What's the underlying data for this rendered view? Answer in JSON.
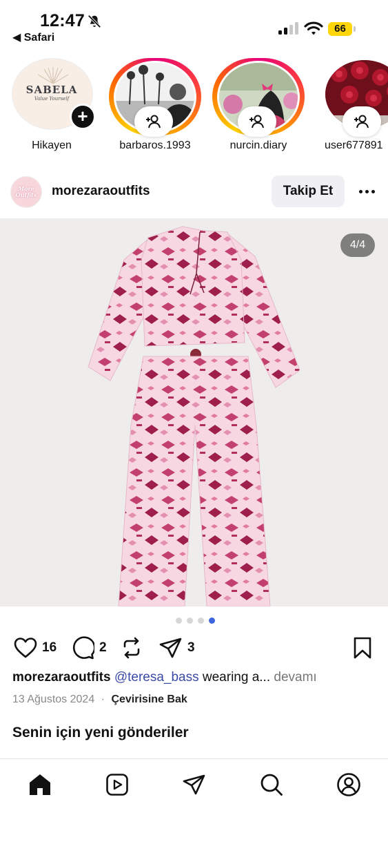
{
  "status_bar": {
    "time": "12:47",
    "back_label": "◀ Safari",
    "battery": "66",
    "battery_color": "#ffd60a"
  },
  "stories": [
    {
      "label": "Hikayen",
      "icon": "add-story-icon",
      "logo_name": "SABELA",
      "logo_sub": "Value Yourself"
    },
    {
      "label": "barbaros.1993",
      "icon": "add-friend-icon"
    },
    {
      "label": "nurcin.diary",
      "icon": "add-friend-icon"
    },
    {
      "label": "user677891",
      "icon": "add-friend-icon"
    }
  ],
  "post": {
    "username": "morezaraoutfits",
    "avatar_text": "More Outfits",
    "follow_label": "Takip Et",
    "counter": "4/4",
    "carousel": {
      "count": 4,
      "active_index": 3
    },
    "likes": "16",
    "comments": "2",
    "shares": "3",
    "caption": {
      "username": "morezaraoutfits",
      "mention": "@teresa_bass",
      "text": " wearing a... ",
      "more": "devamı"
    },
    "date": "13 Ağustos 2024",
    "separator": "·",
    "translate": "Çevirisine Bak"
  },
  "section_title": "Senin için yeni gönderiler",
  "tabbar": [
    "home-icon",
    "reels-icon",
    "send-icon",
    "search-icon",
    "profile-icon"
  ],
  "colors": {
    "accent_blue": "#3f64e0",
    "mention": "#3b4aa6",
    "follow_bg": "#efeff4"
  }
}
